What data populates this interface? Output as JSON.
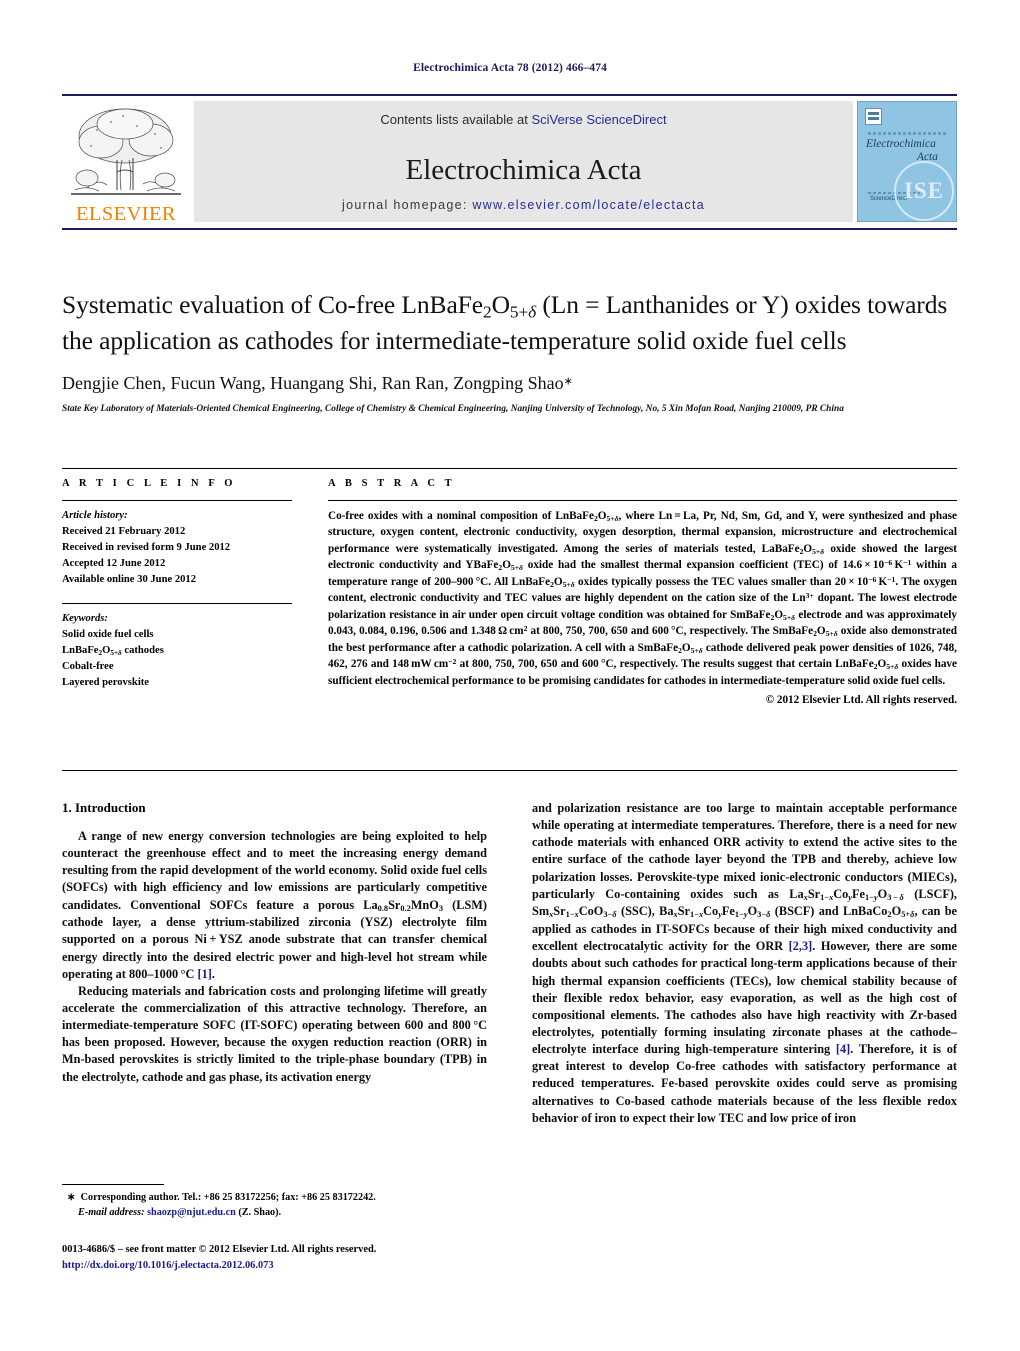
{
  "running_head": "Electrochimica Acta 78 (2012) 466–474",
  "masthead": {
    "publisher_logo_label": "ELSEVIER",
    "contents_prefix": "Contents lists available at ",
    "contents_link": "SciVerse ScienceDirect",
    "journal_title": "Electrochimica Acta",
    "homepage_prefix": "journal homepage: ",
    "homepage_url": "www.elsevier.com/locate/electacta",
    "cover": {
      "line1": "Electrochimica",
      "line2": "Acta",
      "society_mark": "ISE",
      "small_label": "ScienceDirect"
    }
  },
  "article": {
    "title": "Systematic evaluation of Co-free LnBaFe2O5+δ (Ln = Lanthanides or Y) oxides towards the application as cathodes for intermediate-temperature solid oxide fuel cells",
    "authors": "Dengjie Chen, Fucun Wang, Huangang Shi, Ran Ran, Zongping Shao",
    "author_mark": "∗",
    "affiliation": "State Key Laboratory of Materials-Oriented Chemical Engineering, College of Chemistry & Chemical Engineering, Nanjing University of Technology, No, 5 Xin Mofan Road, Nanjing 210009, PR China"
  },
  "article_info": {
    "heading": "A R T I C L E   I N F O",
    "history_label": "Article history:",
    "history": [
      "Received 21 February 2012",
      "Received in revised form 9 June 2012",
      "Accepted 12 June 2012",
      "Available online 30 June 2012"
    ],
    "keywords_label": "Keywords:",
    "keywords": [
      "Solid oxide fuel cells",
      "LnBaFe2O5+δ cathodes",
      "Cobalt-free",
      "Layered perovskite"
    ]
  },
  "abstract": {
    "heading": "A B S T R A C T",
    "text": "Co-free oxides with a nominal composition of LnBaFe2O5+δ, where Ln = La, Pr, Nd, Sm, Gd, and Y, were synthesized and phase structure, oxygen content, electronic conductivity, oxygen desorption, thermal expansion, microstructure and electrochemical performance were systematically investigated. Among the series of materials tested, LaBaFe2O5+δ oxide showed the largest electronic conductivity and YBaFe2O5+δ oxide had the smallest thermal expansion coefficient (TEC) of 14.6 × 10−6 K−1 within a temperature range of 200–900 °C. All LnBaFe2O5+δ oxides typically possess the TEC values smaller than 20 × 10−6 K−1. The oxygen content, electronic conductivity and TEC values are highly dependent on the cation size of the Ln3+ dopant. The lowest electrode polarization resistance in air under open circuit voltage condition was obtained for SmBaFe2O5+δ electrode and was approximately 0.043, 0.084, 0.196, 0.506 and 1.348 Ω cm2 at 800, 750, 700, 650 and 600 °C, respectively. The SmBaFe2O5+δ oxide also demonstrated the best performance after a cathodic polarization. A cell with a SmBaFe2O5+δ cathode delivered peak power densities of 1026, 748, 462, 276 and 148 mW cm−2 at 800, 750, 700, 650 and 600 °C, respectively. The results suggest that certain LnBaFe2O5+δ oxides have sufficient electrochemical performance to be promising candidates for cathodes in intermediate-temperature solid oxide fuel cells.",
    "copyright": "© 2012 Elsevier Ltd. All rights reserved."
  },
  "body": {
    "section_number_title": "1. Introduction",
    "left_paragraphs": [
      "A range of new energy conversion technologies are being exploited to help counteract the greenhouse effect and to meet the increasing energy demand resulting from the rapid development of the world economy. Solid oxide fuel cells (SOFCs) with high efficiency and low emissions are particularly competitive candidates. Conventional SOFCs feature a porous La0.8Sr0.2MnO3 (LSM) cathode layer, a dense yttrium-stabilized zirconia (YSZ) electrolyte film supported on a porous Ni + YSZ anode substrate that can transfer chemical energy directly into the desired electric power and high-level hot stream while operating at 800–1000 °C [1].",
      "Reducing materials and fabrication costs and prolonging lifetime will greatly accelerate the commercialization of this attractive technology. Therefore, an intermediate-temperature SOFC (IT-SOFC) operating between 600 and 800 °C has been proposed. However, because the oxygen reduction reaction (ORR) in Mn-based perovskites is strictly limited to the triple-phase boundary (TPB) in the electrolyte, cathode and gas phase, its activation energy"
    ],
    "right_paragraphs": [
      "and polarization resistance are too large to maintain acceptable performance while operating at intermediate temperatures. Therefore, there is a need for new cathode materials with enhanced ORR activity to extend the active sites to the entire surface of the cathode layer beyond the TPB and thereby, achieve low polarization losses. Perovskite-type mixed ionic-electronic conductors (MIECs), particularly Co-containing oxides such as LaxSr1−xCoyFe1−yO3−δ (LSCF), SmxSr1−xCoO3−δ (SSC), BaxSr1−xCoyFe1−yO3−δ (BSCF) and LnBaCo2O5+δ, can be applied as cathodes in IT-SOFCs because of their high mixed conductivity and excellent electrocatalytic activity for the ORR [2,3]. However, there are some doubts about such cathodes for practical long-term applications because of their high thermal expansion coefficients (TECs), low chemical stability because of their flexible redox behavior, easy evaporation, as well as the high cost of compositional elements. The cathodes also have high reactivity with Zr-based electrolytes, potentially forming insulating zirconate phases at the cathode–electrolyte interface during high-temperature sintering [4]. Therefore, it is of great interest to develop Co-free cathodes with satisfactory performance at reduced temperatures. Fe-based perovskite oxides could serve as promising alternatives to Co-based cathode materials because of the less flexible redox behavior of iron to expect their low TEC and low price of iron"
    ]
  },
  "footnote": {
    "star": "∗",
    "corresponding": "Corresponding author. Tel.: +86 25 83172256; fax: +86 25 83172242.",
    "email_label": "E-mail address:",
    "email": "shaozp@njut.edu.cn",
    "email_suffix": "(Z. Shao)."
  },
  "colophon": {
    "line1": "0013-4686/$ – see front matter © 2012 Elsevier Ltd. All rights reserved.",
    "doi": "http://dx.doi.org/10.1016/j.electacta.2012.06.073"
  },
  "colors": {
    "link": "#2b2b8f",
    "heading_navy": "#1a1a5e",
    "elsevier_orange": "#ef8200",
    "cover_blue": "#8fc4e3",
    "reference_blue": "#1a1a8c"
  }
}
